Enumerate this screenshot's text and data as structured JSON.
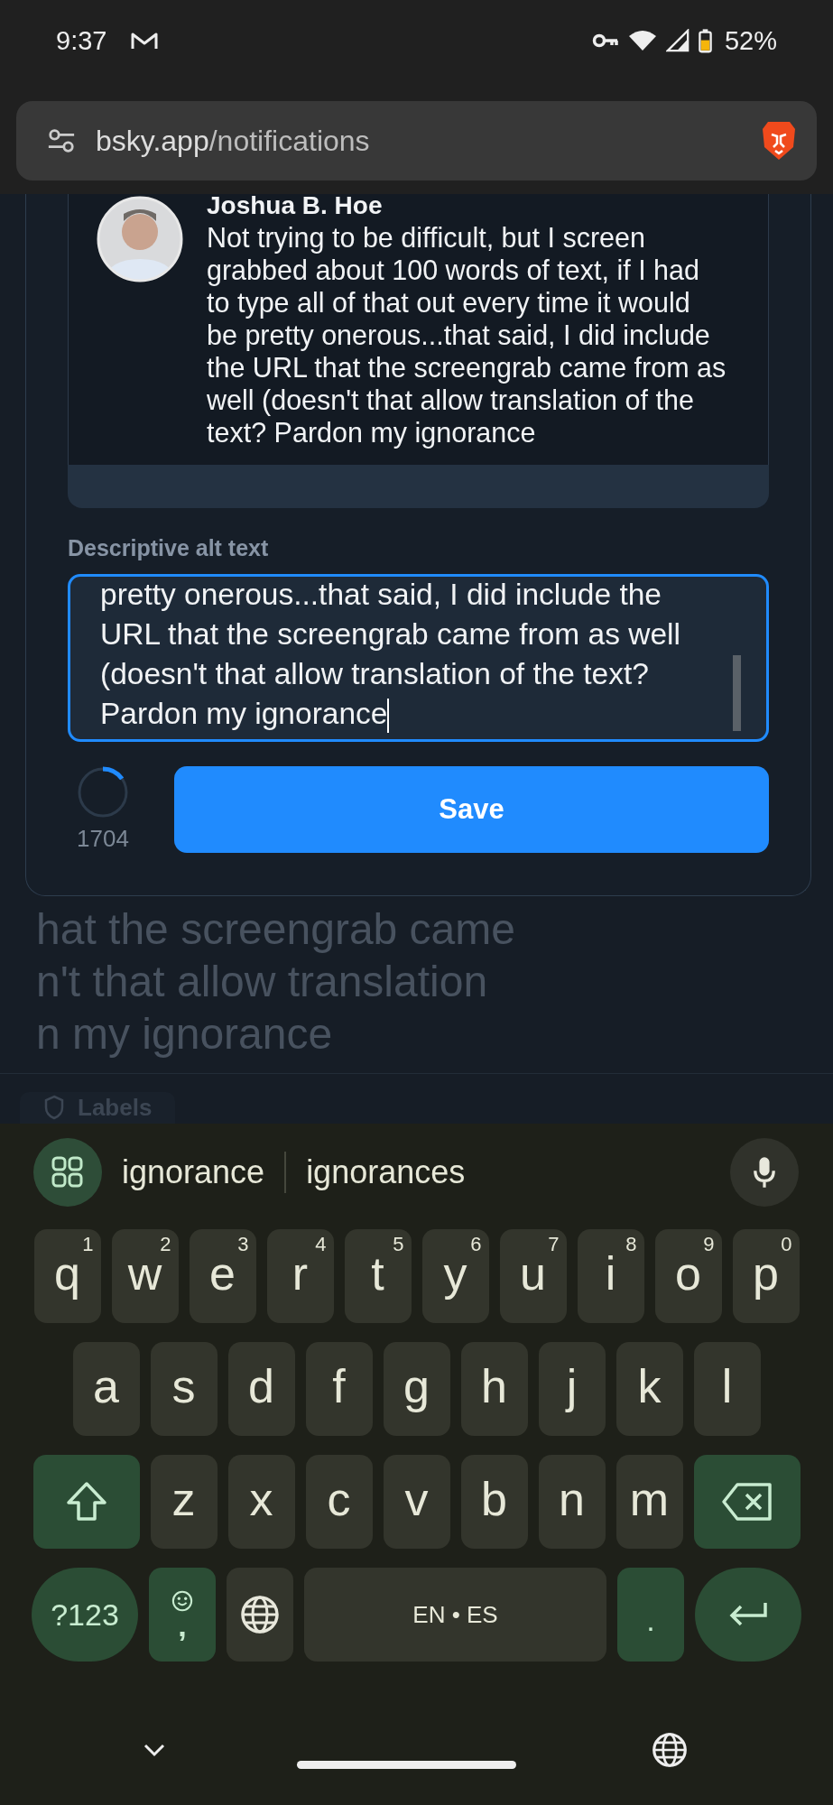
{
  "status_bar": {
    "time": "9:37",
    "battery": "52%"
  },
  "address_bar": {
    "host": "bsky.app",
    "path": "/notifications"
  },
  "quoted_post": {
    "author": "Joshua B. Hoe",
    "text": "Not trying to be difficult, but I screen grabbed about 100 words of text, if I had to type all of that out every time it would be pretty onerous...that said, I did include the URL that the screengrab came from as well (doesn't that allow translation of the text? Pardon my ignorance"
  },
  "alt_text": {
    "label": "Descriptive alt text",
    "value": "pretty onerous...that said, I did include the URL that the screengrab came from as well (doesn't that allow translation of the text? Pardon my ignorance",
    "focused": true,
    "counter": "1704",
    "level": 0.15,
    "save": "Save"
  },
  "background": {
    "lines": [
      "hat the screengrab came",
      "n't that allow translation",
      "n my ignorance"
    ],
    "labels_button": "Labels"
  },
  "keyboard": {
    "suggestions": [
      "ignorance",
      "ignorances"
    ],
    "rows": [
      {
        "keys": [
          {
            "kind": "letter",
            "label": "q",
            "hint": "1"
          },
          {
            "kind": "letter",
            "label": "w",
            "hint": "2"
          },
          {
            "kind": "letter",
            "label": "e",
            "hint": "3"
          },
          {
            "kind": "letter",
            "label": "r",
            "hint": "4"
          },
          {
            "kind": "letter",
            "label": "t",
            "hint": "5"
          },
          {
            "kind": "letter",
            "label": "y",
            "hint": "6"
          },
          {
            "kind": "letter",
            "label": "u",
            "hint": "7"
          },
          {
            "kind": "letter",
            "label": "i",
            "hint": "8"
          },
          {
            "kind": "letter",
            "label": "o",
            "hint": "9"
          },
          {
            "kind": "letter",
            "label": "p",
            "hint": "0"
          }
        ]
      },
      {
        "keys": [
          {
            "kind": "letter",
            "label": "a"
          },
          {
            "kind": "letter",
            "label": "s"
          },
          {
            "kind": "letter",
            "label": "d"
          },
          {
            "kind": "letter",
            "label": "f"
          },
          {
            "kind": "letter",
            "label": "g"
          },
          {
            "kind": "letter",
            "label": "h"
          },
          {
            "kind": "letter",
            "label": "j"
          },
          {
            "kind": "letter",
            "label": "k"
          },
          {
            "kind": "letter",
            "label": "l"
          }
        ]
      },
      {
        "keys": [
          {
            "kind": "shift"
          },
          {
            "kind": "letter",
            "label": "z"
          },
          {
            "kind": "letter",
            "label": "x"
          },
          {
            "kind": "letter",
            "label": "c"
          },
          {
            "kind": "letter",
            "label": "v"
          },
          {
            "kind": "letter",
            "label": "b"
          },
          {
            "kind": "letter",
            "label": "n"
          },
          {
            "kind": "letter",
            "label": "m"
          },
          {
            "kind": "backspace"
          }
        ]
      },
      {
        "keys": [
          {
            "kind": "symbols",
            "label": "?123"
          },
          {
            "kind": "emoji_comma",
            "label": ","
          },
          {
            "kind": "globe"
          },
          {
            "kind": "space",
            "label": "EN • ES"
          },
          {
            "kind": "period",
            "label": "."
          },
          {
            "kind": "enter"
          }
        ]
      }
    ]
  }
}
